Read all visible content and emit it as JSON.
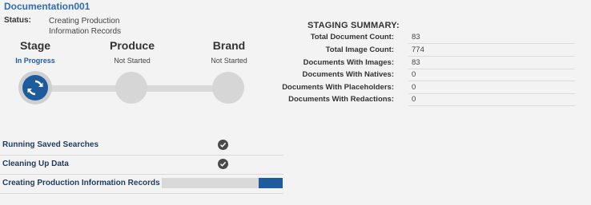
{
  "header": {
    "title": "Documentation001",
    "status_label": "Status:",
    "status_value": "Creating Production Information Records"
  },
  "stages": [
    {
      "name": "Stage",
      "status": "In Progress",
      "active": true,
      "icon": "sync-icon"
    },
    {
      "name": "Produce",
      "status": "Not Started",
      "active": false
    },
    {
      "name": "Brand",
      "status": "Not Started",
      "active": false
    }
  ],
  "tasks": [
    {
      "label": "Running Saved Searches",
      "state": "complete",
      "icon": "checkmark-icon"
    },
    {
      "label": "Cleaning Up Data",
      "state": "complete",
      "icon": "checkmark-icon"
    },
    {
      "label": "Creating Production Information Records",
      "state": "in-progress",
      "progress": 0.2
    }
  ],
  "summary": {
    "title": "STAGING SUMMARY:",
    "rows": [
      {
        "label": "Total Document Count:",
        "value": "83"
      },
      {
        "label": "Total Image Count:",
        "value": "774"
      },
      {
        "label": "Documents With Images:",
        "value": "83"
      },
      {
        "label": "Documents With Natives:",
        "value": "0"
      },
      {
        "label": "Documents With Placeholders:",
        "value": "0"
      },
      {
        "label": "Documents With Redactions:",
        "value": "0"
      }
    ]
  },
  "colors": {
    "accent": "#1e5b9c",
    "title": "#2f6db5",
    "inactive": "#d6d6d6",
    "background": "#f3f3f3"
  }
}
